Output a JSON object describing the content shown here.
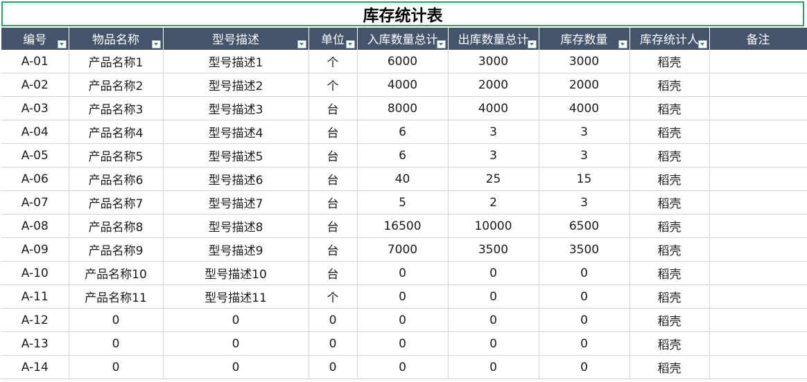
{
  "sheet": {
    "title": "库存统计表",
    "columns": [
      "编号",
      "物品名称",
      "型号描述",
      "单位",
      "入库数量总计",
      "出库数量总计",
      "库存数量",
      "库存统计人",
      "备注"
    ],
    "filters": [
      true,
      true,
      true,
      true,
      true,
      true,
      true,
      true,
      false
    ],
    "rows": [
      [
        "A-01",
        "产品名称1",
        "型号描述1",
        "个",
        "6000",
        "3000",
        "3000",
        "稻壳",
        ""
      ],
      [
        "A-02",
        "产品名称2",
        "型号描述2",
        "个",
        "4000",
        "2000",
        "2000",
        "稻壳",
        ""
      ],
      [
        "A-03",
        "产品名称3",
        "型号描述3",
        "台",
        "8000",
        "4000",
        "4000",
        "稻壳",
        ""
      ],
      [
        "A-04",
        "产品名称4",
        "型号描述4",
        "台",
        "6",
        "3",
        "3",
        "稻壳",
        ""
      ],
      [
        "A-05",
        "产品名称5",
        "型号描述5",
        "台",
        "6",
        "3",
        "3",
        "稻壳",
        ""
      ],
      [
        "A-06",
        "产品名称6",
        "型号描述6",
        "台",
        "40",
        "25",
        "15",
        "稻壳",
        ""
      ],
      [
        "A-07",
        "产品名称7",
        "型号描述7",
        "台",
        "5",
        "2",
        "3",
        "稻壳",
        ""
      ],
      [
        "A-08",
        "产品名称8",
        "型号描述8",
        "台",
        "16500",
        "10000",
        "6500",
        "稻壳",
        ""
      ],
      [
        "A-09",
        "产品名称9",
        "型号描述9",
        "台",
        "7000",
        "3500",
        "3500",
        "稻壳",
        ""
      ],
      [
        "A-10",
        "产品名称10",
        "型号描述10",
        "台",
        "0",
        "0",
        "0",
        "稻壳",
        ""
      ],
      [
        "A-11",
        "产品名称11",
        "型号描述11",
        "个",
        "0",
        "0",
        "0",
        "稻壳",
        ""
      ],
      [
        "A-12",
        "0",
        "0",
        "0",
        "0",
        "0",
        "0",
        "稻壳",
        ""
      ],
      [
        "A-13",
        "0",
        "0",
        "0",
        "0",
        "0",
        "0",
        "稻壳",
        ""
      ],
      [
        "A-14",
        "0",
        "0",
        "0",
        "0",
        "0",
        "0",
        "稻壳",
        ""
      ]
    ]
  },
  "icons": {
    "filter": "filter-dropdown-icon"
  },
  "colors": {
    "header_bg": "#44546a",
    "header_text": "#ffffff",
    "selection_border": "#21a366",
    "filter_arrow": "#1e9e5a",
    "grid": "#d4d4d4"
  }
}
